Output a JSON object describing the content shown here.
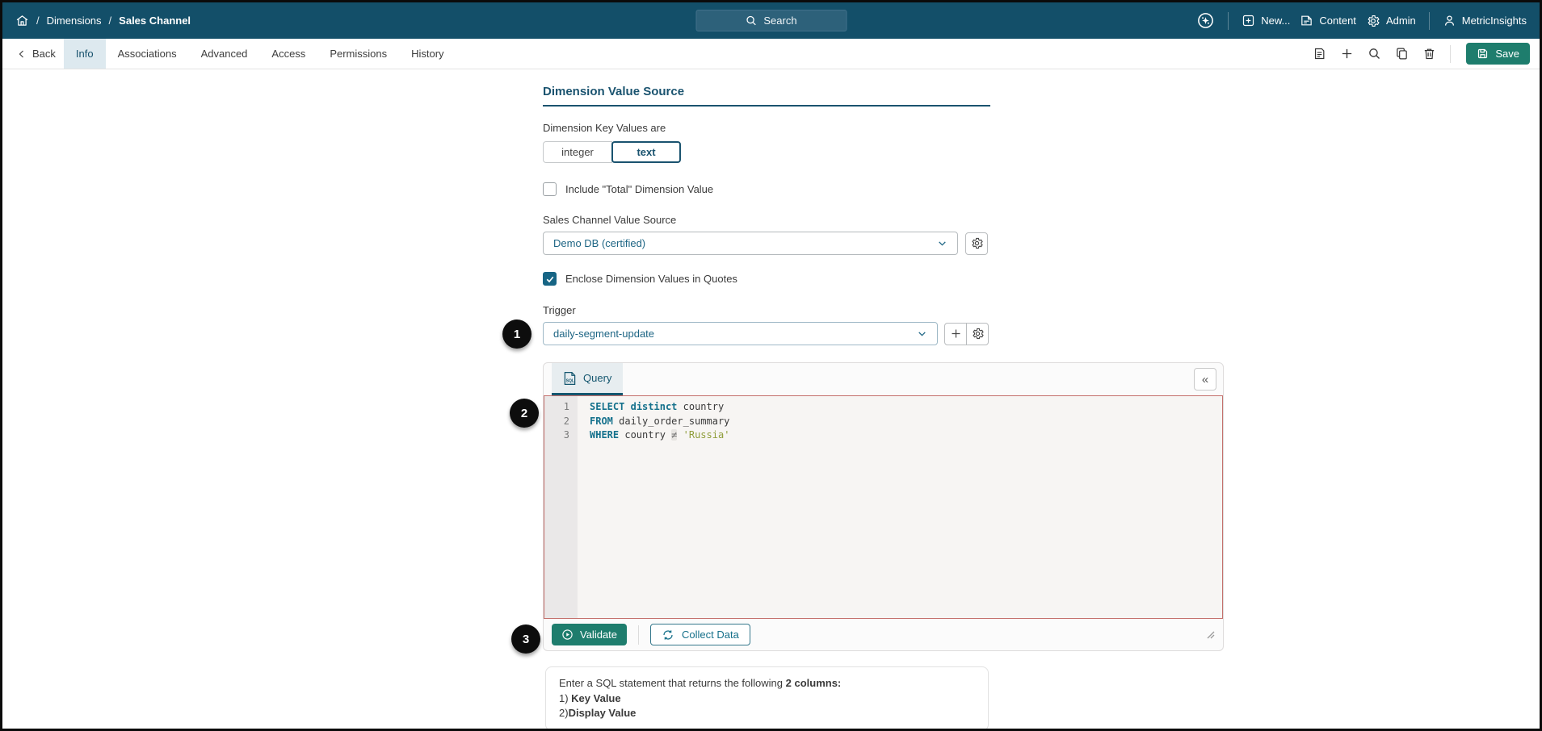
{
  "colors": {
    "navbar_bg": "#134f69",
    "accent": "#1a536f",
    "button_teal": "#1e7d6d",
    "editor_border": "#c4706c",
    "keyword": "#15718c",
    "string": "#8f9d3a"
  },
  "navbar": {
    "breadcrumb": {
      "sep": "/",
      "section": "Dimensions",
      "current": "Sales Channel"
    },
    "search_label": "Search",
    "menu": [
      {
        "label": "New..."
      },
      {
        "label": "Content"
      },
      {
        "label": "Admin"
      },
      {
        "label": "MetricInsights"
      }
    ]
  },
  "toolbar": {
    "back_label": "Back",
    "tabs": [
      {
        "label": "Info"
      },
      {
        "label": "Associations"
      },
      {
        "label": "Advanced"
      },
      {
        "label": "Access"
      },
      {
        "label": "Permissions"
      },
      {
        "label": "History"
      }
    ],
    "save_label": "Save"
  },
  "main": {
    "section_title": "Dimension Value Source",
    "key_values_label": "Dimension Key Values are",
    "key_values_options": [
      {
        "label": "integer"
      },
      {
        "label": "text"
      }
    ],
    "include_total_label": "Include \"Total\" Dimension Value",
    "value_source_label": "Sales Channel Value Source",
    "value_source_value": "Demo DB (certified)",
    "enclose_quotes_label": "Enclose Dimension Values in Quotes",
    "trigger_label": "Trigger",
    "trigger_value": "daily-segment-update",
    "badges": {
      "one": "1",
      "two": "2",
      "three": "3"
    },
    "query": {
      "tab_label": "Query",
      "collapse_glyph": "«",
      "lines": [
        {
          "num": "1",
          "tokens": [
            [
              "kw",
              "SELECT"
            ],
            [
              "txt",
              " "
            ],
            [
              "kw",
              "distinct"
            ],
            [
              "txt",
              " country"
            ]
          ]
        },
        {
          "num": "2",
          "tokens": [
            [
              "kw",
              "FROM"
            ],
            [
              "txt",
              " daily_order_summary"
            ]
          ]
        },
        {
          "num": "3",
          "tokens": [
            [
              "kw",
              "WHERE"
            ],
            [
              "txt",
              " country "
            ],
            [
              "op",
              "≠"
            ],
            [
              "txt",
              " "
            ],
            [
              "str",
              "'Russia'"
            ]
          ]
        }
      ],
      "validate_label": "Validate",
      "collect_label": "Collect Data"
    },
    "help": {
      "line1_normal": "Enter a SQL statement that returns the following ",
      "line1_bold": "2 columns:",
      "line2_prefix": "1) ",
      "line2_bold": "Key Value",
      "line3_prefix": "2)",
      "line3_bold": "Display Value"
    }
  }
}
